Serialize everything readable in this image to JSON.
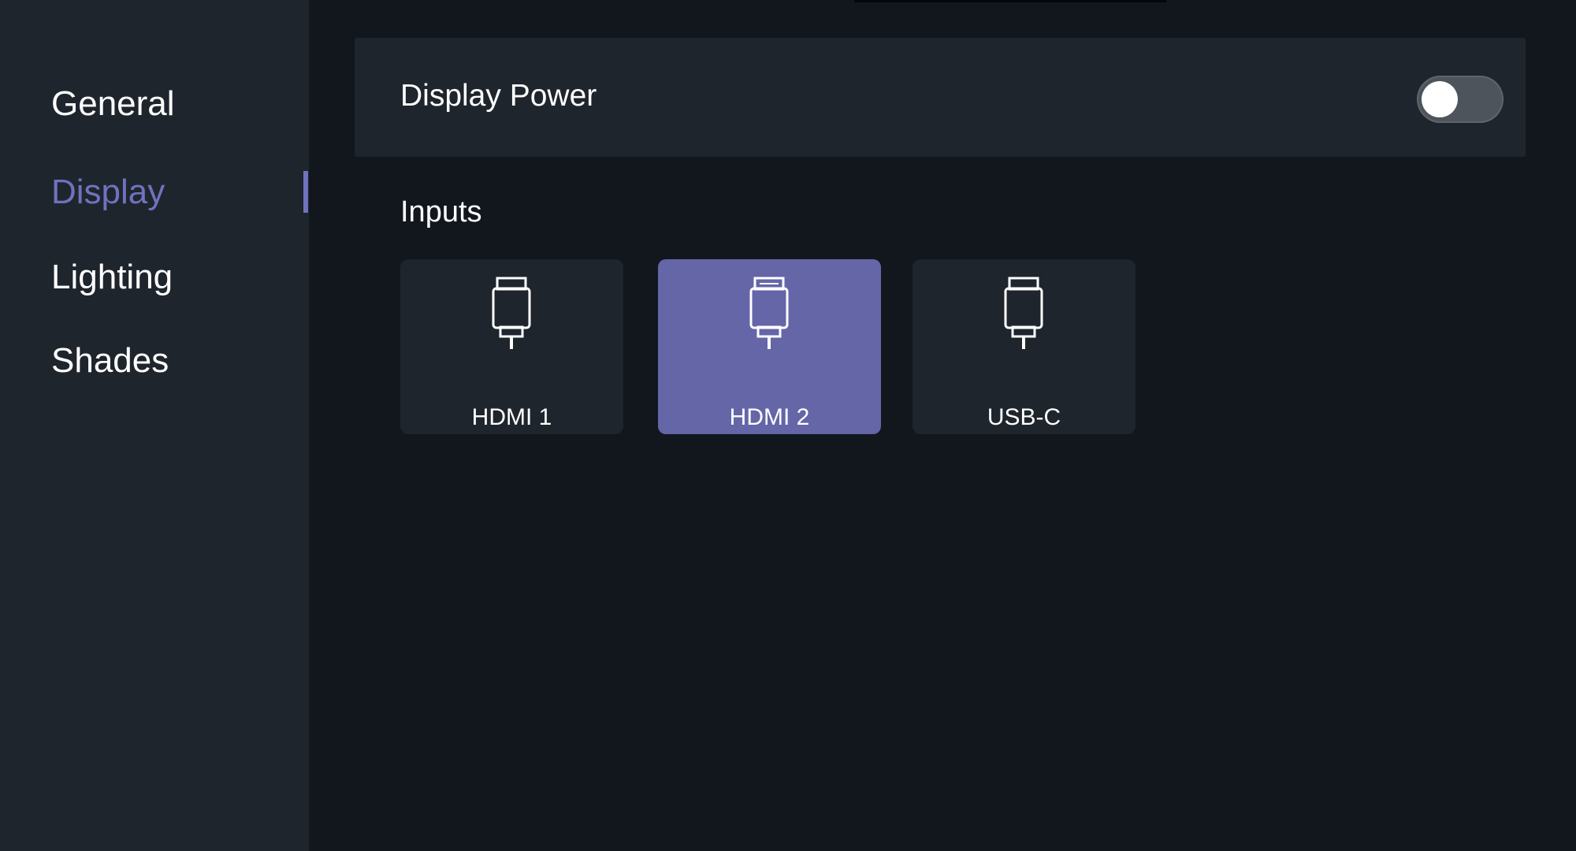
{
  "sidebar": {
    "items": [
      {
        "label": "General",
        "active": false
      },
      {
        "label": "Display",
        "active": true
      },
      {
        "label": "Lighting",
        "active": false
      },
      {
        "label": "Shades",
        "active": false
      }
    ]
  },
  "main": {
    "display_power": {
      "label": "Display Power",
      "enabled": false
    },
    "inputs": {
      "title": "Inputs",
      "options": [
        {
          "label": "HDMI 1",
          "icon": "plug-icon",
          "selected": false
        },
        {
          "label": "HDMI 2",
          "icon": "plug-icon",
          "selected": true
        },
        {
          "label": "USB-C",
          "icon": "plug-icon",
          "selected": false
        }
      ]
    }
  },
  "colors": {
    "accent": "#6466a8",
    "active_text": "#6f72c0",
    "sidebar_bg": "#1f252c",
    "main_bg": "#11171d"
  }
}
